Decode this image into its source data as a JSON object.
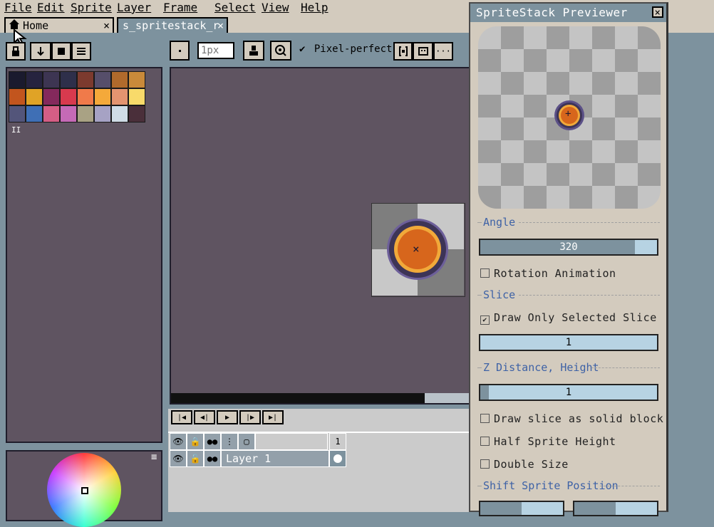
{
  "menu": [
    "File",
    "Edit",
    "Sprite",
    "Layer",
    "Frame",
    "Select",
    "View",
    "Help"
  ],
  "tabs": [
    {
      "label": "Home",
      "icon": "home-icon",
      "close": "×"
    },
    {
      "label": "s_spritestack_r",
      "close": "×"
    }
  ],
  "toolbar": {
    "brush_size_placeholder": "1px",
    "pixel_perfect_label": "Pixel-perfect",
    "pixel_perfect_checked": true
  },
  "palette": {
    "colors": [
      "#1a1a2e",
      "#26233f",
      "#3d3552",
      "#2e2f4a",
      "#7c3a2e",
      "#564e6a",
      "#b06a2c",
      "#c98a3a",
      "#c2551e",
      "#e0a326",
      "#84295c",
      "#d83a4e",
      "#f07a4a",
      "#f4a93a",
      "#e49470",
      "#f8da6a",
      "#53557a",
      "#3f6fb5",
      "#d45e85",
      "#c56ab6",
      "#a9a284",
      "#a6a2c4",
      "#cfdce6",
      "#4a2f3a"
    ],
    "pause_glyph": "II"
  },
  "timeline": {
    "frame_number": "1",
    "layer_name": "Layer 1"
  },
  "previewer": {
    "title": "SpriteStack Previewer",
    "close": "×",
    "angle_section": "Angle",
    "angle_value": "320",
    "angle_fraction": 0.875,
    "rotation_animation": "Rotation Animation",
    "rotation_checked": false,
    "slice_section": "Slice",
    "draw_only_selected": "Draw Only Selected Slice",
    "draw_only_selected_checked": true,
    "slice_value": "1",
    "z_section": "Z Distance, Height",
    "z_value": "1",
    "draw_solid": "Draw slice as solid block",
    "draw_solid_checked": false,
    "half_height": "Half Sprite Height",
    "half_height_checked": false,
    "double_size": "Double Size",
    "double_size_checked": false,
    "shift_section": "Shift Sprite Position"
  },
  "colors": {
    "ui_bg": "#d3cbbe",
    "workspace": "#7d929e",
    "canvas": "#5f5461",
    "accent_text": "#3e62a6",
    "sprite_orange": "#d7661c",
    "sprite_ring": "#f1a93a",
    "sprite_outline": "#3d3456"
  }
}
